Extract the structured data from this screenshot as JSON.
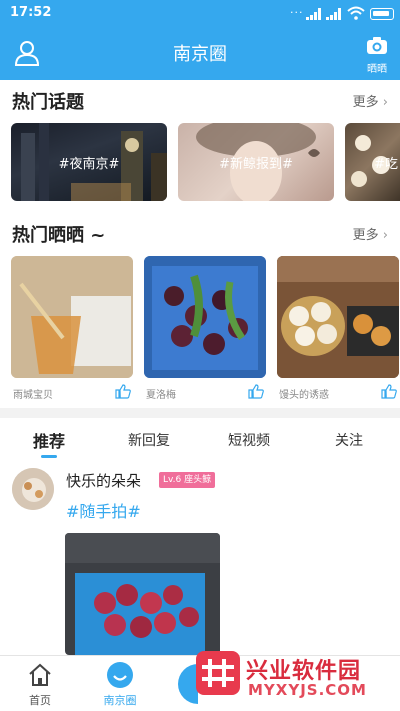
{
  "status_bar": {
    "time": "17:52",
    "dots": "···"
  },
  "header": {
    "title": "南京圈",
    "camera_label": "晒晒"
  },
  "hot_topics": {
    "title": "热门话题",
    "more": "更多",
    "items": [
      {
        "tag": "#夜南京#"
      },
      {
        "tag": "#新鲸报到#"
      },
      {
        "tag": "#吃"
      }
    ]
  },
  "hot_posts": {
    "title": "热门晒晒 ~",
    "more": "更多",
    "items": [
      {
        "caption": "雨城宝贝"
      },
      {
        "caption": "夏洛梅"
      },
      {
        "caption": "馒头的诱惑"
      }
    ]
  },
  "feed_tabs": [
    {
      "label": "推荐"
    },
    {
      "label": "新回复"
    },
    {
      "label": "短视频"
    },
    {
      "label": "关注"
    }
  ],
  "feed": {
    "post": {
      "username": "快乐的朵朵",
      "level": "Lv.6 座头鲸",
      "hashtag": "#随手拍#"
    }
  },
  "bottom_nav": [
    {
      "label": "首页",
      "active": false
    },
    {
      "label": "南京圈",
      "active": true
    }
  ],
  "watermark": {
    "cn": "兴业软件园",
    "en": "MYXYJS.COM"
  },
  "colors": {
    "primary": "#35a8ee",
    "level_badge": "#f06e9a",
    "watermark": "#d92c3e"
  }
}
